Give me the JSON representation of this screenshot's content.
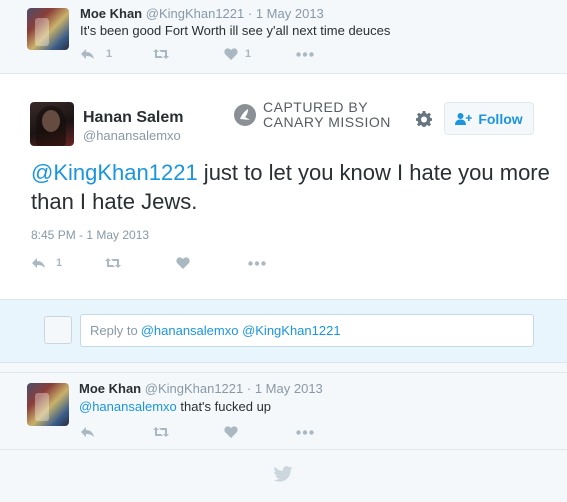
{
  "tweet1": {
    "name": "Moe Khan",
    "handle": "@KingKhan1221",
    "sep": "·",
    "date": "1 May 2013",
    "text": "It's been good Fort Worth ill see y'all next time deuces",
    "reply_count": "1",
    "like_count": "1"
  },
  "main_tweet": {
    "name": "Hanan Salem",
    "handle": "@hanansalemxo",
    "mention": "@KingKhan1221",
    "text": " just to let you know I hate you more than I hate Jews.",
    "timestamp": "8:45 PM - 1 May 2013",
    "reply_count": "1"
  },
  "watermark": {
    "line1": "CAPTURED BY",
    "line2": "CANARY MISSION"
  },
  "follow_label": "Follow",
  "reply_box": {
    "prefix": "Reply to ",
    "mentions": "@hanansalemxo @KingKhan1221"
  },
  "tweet3": {
    "name": "Moe Khan",
    "handle": "@KingKhan1221",
    "sep": "·",
    "date": "1 May 2013",
    "mention": "@hanansalemxo",
    "text": " that's fucked up"
  },
  "colors": {
    "accent": "#1b95e0",
    "icon": "#aab8c2",
    "footer_bird": "#ccd6dd"
  },
  "icons": [
    "reply-icon",
    "retweet-icon",
    "heart-icon",
    "more-icon",
    "gear-icon",
    "follow-user-icon",
    "canary-icon",
    "twitter-bird-icon"
  ]
}
